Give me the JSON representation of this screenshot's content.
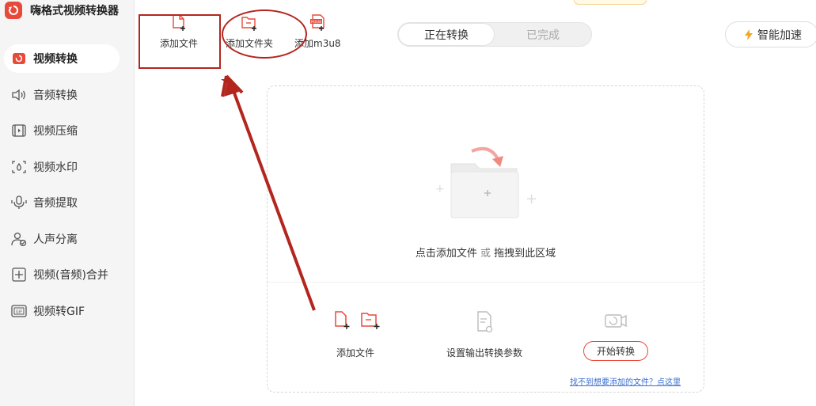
{
  "app": {
    "title": "嗨格式视频转换器"
  },
  "sidebar": {
    "items": [
      {
        "label": "视频转换",
        "icon": "video-convert-icon",
        "active": true
      },
      {
        "label": "音频转换",
        "icon": "audio-speaker-icon",
        "active": false
      },
      {
        "label": "视频压缩",
        "icon": "video-compress-icon",
        "active": false
      },
      {
        "label": "视频水印",
        "icon": "watermark-icon",
        "active": false
      },
      {
        "label": "音频提取",
        "icon": "audio-extract-icon",
        "active": false
      },
      {
        "label": "人声分离",
        "icon": "voice-separate-icon",
        "active": false
      },
      {
        "label": "视频(音频)合并",
        "icon": "merge-icon",
        "active": false
      },
      {
        "label": "视频转GIF",
        "icon": "gif-icon",
        "active": false
      }
    ]
  },
  "toolbar": {
    "add_file": "添加文件",
    "add_folder": "添加文件夹",
    "add_m3u8": "添加m3u8",
    "m3u8_badge": "M3U8",
    "tabs": {
      "converting": "正在转换",
      "completed": "已完成"
    },
    "accelerate": "智能加速"
  },
  "dropzone": {
    "hint_click": "点击添加文件",
    "hint_or": "或",
    "hint_drag": "拖拽到此区域",
    "step1": "添加文件",
    "step2": "设置输出转换参数",
    "start": "开始转换",
    "help": "找不到想要添加的文件？点这里"
  },
  "colors": {
    "accent": "#e84a3a",
    "annotation": "#b3261e",
    "link": "#3b6fd0"
  }
}
